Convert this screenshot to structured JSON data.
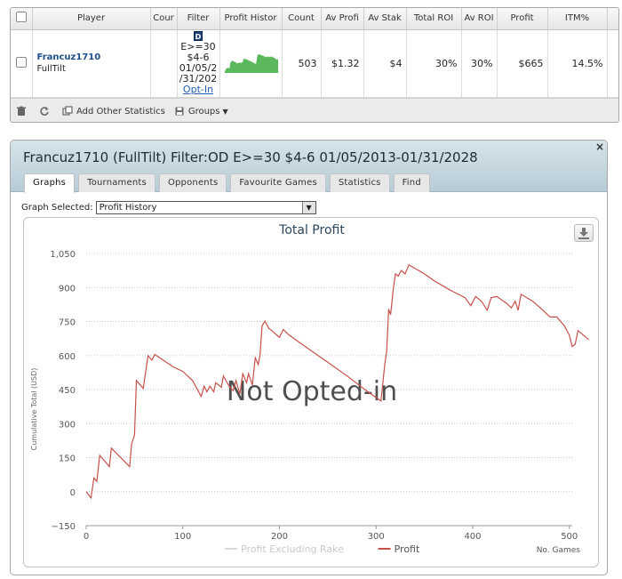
{
  "stats_table": {
    "columns": [
      "Player",
      "Cour",
      "Filter",
      "Profit Histor",
      "Count",
      "Av Profi",
      "Av Stak",
      "Total ROI",
      "Av ROI",
      "Profit",
      "ITM%"
    ],
    "row": {
      "player_name": "Francuz1710",
      "site": "FullTilt",
      "filter_badge": "D",
      "filter_lines": [
        "E>=30",
        "$4-6",
        "01/05/2",
        "/31/202"
      ],
      "opt_in": "Opt-In",
      "count": "503",
      "av_profit": "$1.32",
      "av_stake": "$4",
      "total_roi": "30%",
      "av_roi": "30%",
      "profit": "$665",
      "itm": "14.5%",
      "remove": "x"
    },
    "sparkline_color": "#5cb85c"
  },
  "toolbar": {
    "add_stats_label": "Add Other Statistics",
    "groups_label": "Groups"
  },
  "graph_panel": {
    "title": "Francuz1710 (FullTilt) Filter:OD E>=30 $4-6 01/05/2013-01/31/2028",
    "tabs": [
      "Graphs",
      "Tournaments",
      "Opponents",
      "Favourite Games",
      "Statistics",
      "Find"
    ],
    "active_tab": "Graphs",
    "close_label": "×",
    "graph_selected_label": "Graph Selected:",
    "graph_selected_value": "Profit History"
  },
  "chart_data": {
    "type": "line",
    "title": "Total Profit",
    "xlabel": "No. Games",
    "ylabel": "Cumulative Total (USD)",
    "xlim": [
      0,
      503
    ],
    "ylim": [
      -150,
      1050
    ],
    "x_ticks": [
      0,
      100,
      200,
      300,
      400,
      500
    ],
    "y_ticks": [
      -150,
      0,
      150,
      300,
      450,
      600,
      750,
      900,
      1050
    ],
    "y_tick_labels": [
      "−150",
      "0",
      "150",
      "300",
      "450",
      "600",
      "750",
      "900",
      "1,050"
    ],
    "grid": "horizontal dotted",
    "watermark": "Not Opted-in",
    "legend_position": "bottom-center",
    "series": [
      {
        "name": "Profit Excluding Rake",
        "color": "#d8d8d8",
        "points": []
      },
      {
        "name": "Profit",
        "color": "#c8504a",
        "points": [
          [
            0,
            0
          ],
          [
            5,
            -28
          ],
          [
            8,
            60
          ],
          [
            11,
            45
          ],
          [
            14,
            160
          ],
          [
            24,
            110
          ],
          [
            26,
            192
          ],
          [
            45,
            110
          ],
          [
            47,
            210
          ],
          [
            50,
            250
          ],
          [
            52,
            490
          ],
          [
            59,
            455
          ],
          [
            64,
            600
          ],
          [
            68,
            580
          ],
          [
            71,
            605
          ],
          [
            90,
            550
          ],
          [
            100,
            530
          ],
          [
            110,
            490
          ],
          [
            119,
            420
          ],
          [
            122,
            465
          ],
          [
            125,
            440
          ],
          [
            128,
            465
          ],
          [
            132,
            440
          ],
          [
            134,
            480
          ],
          [
            140,
            460
          ],
          [
            142,
            510
          ],
          [
            148,
            465
          ],
          [
            152,
            445
          ],
          [
            155,
            490
          ],
          [
            159,
            430
          ],
          [
            162,
            520
          ],
          [
            166,
            480
          ],
          [
            168,
            520
          ],
          [
            172,
            470
          ],
          [
            175,
            590
          ],
          [
            178,
            560
          ],
          [
            180,
            605
          ],
          [
            182,
            730
          ],
          [
            185,
            752
          ],
          [
            189,
            720
          ],
          [
            192,
            710
          ],
          [
            196,
            695
          ],
          [
            200,
            680
          ],
          [
            204,
            715
          ],
          [
            210,
            690
          ],
          [
            230,
            630
          ],
          [
            250,
            570
          ],
          [
            270,
            510
          ],
          [
            290,
            445
          ],
          [
            305,
            400
          ],
          [
            307,
            480
          ],
          [
            309,
            560
          ],
          [
            311,
            620
          ],
          [
            313,
            805
          ],
          [
            315,
            780
          ],
          [
            318,
            900
          ],
          [
            320,
            960
          ],
          [
            323,
            950
          ],
          [
            326,
            975
          ],
          [
            330,
            960
          ],
          [
            334,
            1000
          ],
          [
            350,
            960
          ],
          [
            360,
            930
          ],
          [
            376,
            890
          ],
          [
            392,
            855
          ],
          [
            398,
            820
          ],
          [
            403,
            860
          ],
          [
            409,
            840
          ],
          [
            415,
            800
          ],
          [
            419,
            855
          ],
          [
            425,
            860
          ],
          [
            435,
            830
          ],
          [
            440,
            810
          ],
          [
            444,
            840
          ],
          [
            447,
            800
          ],
          [
            450,
            870
          ],
          [
            462,
            840
          ],
          [
            470,
            810
          ],
          [
            480,
            770
          ],
          [
            487,
            770
          ],
          [
            495,
            730
          ],
          [
            500,
            690
          ],
          [
            503,
            640
          ],
          [
            506,
            650
          ],
          [
            509,
            710
          ],
          [
            520,
            670
          ]
        ]
      }
    ]
  }
}
